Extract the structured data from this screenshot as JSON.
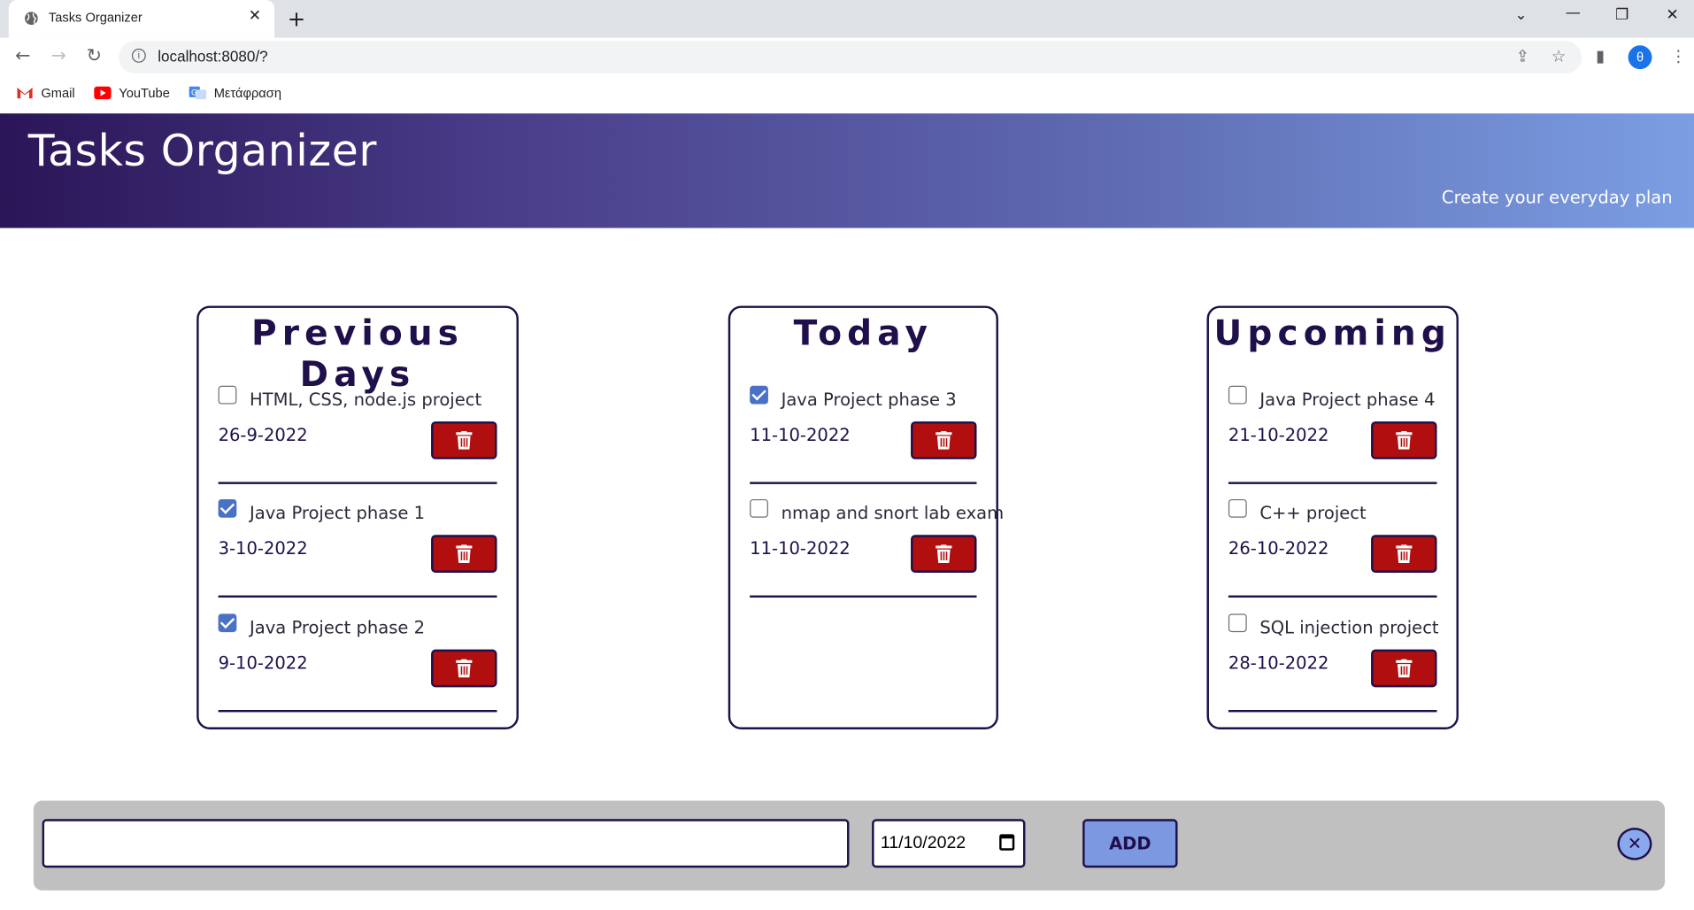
{
  "browser": {
    "tab_title": "Tasks Organizer",
    "tab_close": "✕",
    "new_tab": "+",
    "url": "localhost:8080/?",
    "profile_initial": "θ",
    "bookmarks": [
      {
        "label": "Gmail",
        "icon": "gmail-icon"
      },
      {
        "label": "YouTube",
        "icon": "youtube-icon"
      },
      {
        "label": "Μετάφραση",
        "icon": "translate-icon"
      }
    ]
  },
  "header": {
    "title": "Tasks Organizer",
    "subtitle": "Create your everyday plan"
  },
  "columns": [
    {
      "title": "Previous Days",
      "tasks": [
        {
          "name": "HTML, CSS, node.js project",
          "date": "26-9-2022",
          "done": false
        },
        {
          "name": "Java Project phase 1",
          "date": "3-10-2022",
          "done": true
        },
        {
          "name": "Java Project phase 2",
          "date": "9-10-2022",
          "done": true
        }
      ]
    },
    {
      "title": "Today",
      "tasks": [
        {
          "name": "Java Project phase 3",
          "date": "11-10-2022",
          "done": true
        },
        {
          "name": "nmap and snort lab exam",
          "date": "11-10-2022",
          "done": false
        }
      ]
    },
    {
      "title": "Upcoming",
      "tasks": [
        {
          "name": "Java Project phase 4",
          "date": "21-10-2022",
          "done": false
        },
        {
          "name": "C++ project",
          "date": "26-10-2022",
          "done": false
        },
        {
          "name": "SQL injection project",
          "date": "28-10-2022",
          "done": false
        }
      ]
    }
  ],
  "add_bar": {
    "task_input_value": "",
    "date_value": "11/10/2022",
    "add_label": "ADD",
    "close_label": "✕"
  },
  "colors": {
    "accent": "#1f0f4a",
    "delete_button": "#b10f0f",
    "add_button": "#7b98e0",
    "checkbox_checked": "#4a72c4"
  }
}
